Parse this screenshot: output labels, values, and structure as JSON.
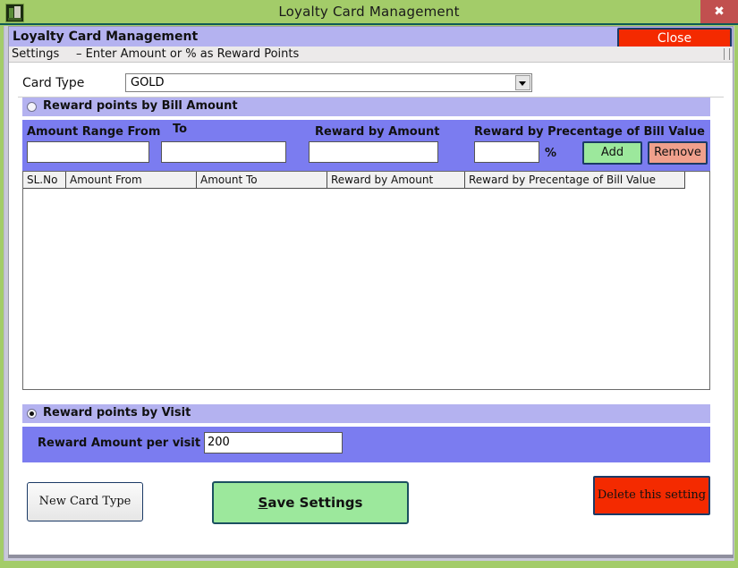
{
  "window": {
    "title": "Loyalty Card Management",
    "icon": "app-icon",
    "close_glyph": "✖"
  },
  "header": {
    "title": "Loyalty Card Management",
    "close_label": "Close",
    "close_bg": "#f42a00"
  },
  "settings_bar": {
    "label": "Settings",
    "hint": "– Enter Amount or % as Reward Points"
  },
  "card_type": {
    "label": "Card Type",
    "value": "GOLD",
    "arrow": "chevron-down-icon"
  },
  "bill_section": {
    "radio_label": "Reward points by Bill Amount",
    "selected": false,
    "fields": {
      "amount_from_label": "Amount Range  From",
      "amount_to_label": "To",
      "reward_by_amount_label": "Reward by Amount",
      "reward_by_percentage_label": "Reward by Precentage of Bill Value",
      "amount_from_value": "",
      "amount_to_value": "",
      "reward_by_amount_value": "",
      "reward_by_percentage_value": "",
      "percent_sign": "%"
    },
    "add_label": "Add",
    "remove_label": "Remove",
    "add_bg": "#9ce89c",
    "remove_bg": "#f0a08c"
  },
  "grid": {
    "columns": [
      "SL.No",
      "Amount From",
      "Amount  To",
      "Reward by Amount",
      "Reward by Precentage of Bill Value"
    ],
    "rows": []
  },
  "visit_section": {
    "radio_label": "Reward points by Visit",
    "selected": true,
    "amount_label": "Reward Amount  per visit",
    "amount_value": "200"
  },
  "footer": {
    "new_card_label": "New Card Type",
    "save_label_prefix": "S",
    "save_label_rest": "ave Settings",
    "delete_label": "Delete this setting",
    "save_bg": "#9ce89c",
    "delete_bg": "#f42a00"
  }
}
